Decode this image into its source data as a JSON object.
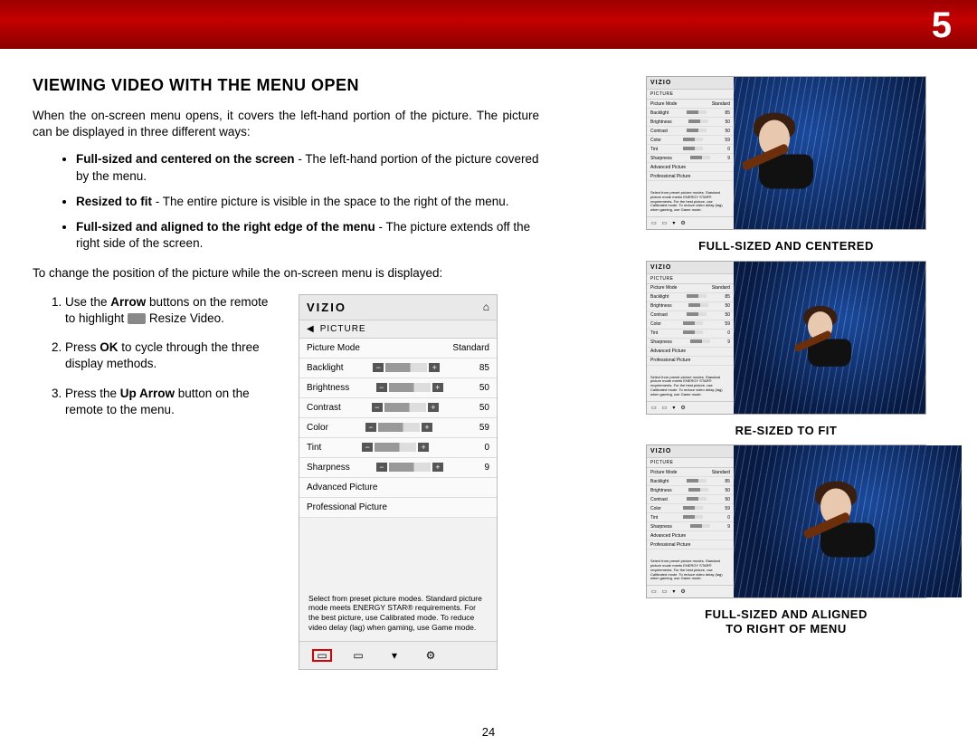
{
  "chapter_number": "5",
  "page_number": "24",
  "section_title": "VIEWING VIDEO WITH THE MENU OPEN",
  "intro": "When the on-screen menu opens, it covers the left-hand portion of the picture. The picture can be displayed in three different ways:",
  "ways": [
    {
      "lead": "Full-sized and centered on the screen",
      "desc": " - The left-hand portion of the picture covered by the menu."
    },
    {
      "lead": "Resized to fit",
      "desc": " - The entire picture is visible in the space to the right of the menu."
    },
    {
      "lead": "Full-sized and aligned to the right edge of the menu",
      "desc": " - The picture extends off the right side of the screen."
    }
  ],
  "change_pos": "To change the position of the picture while the on-screen menu is displayed:",
  "steps": [
    {
      "pre": "Use the ",
      "bold": "Arrow",
      "post": " buttons on the remote to highlight ",
      "tail": " Resize Video.",
      "has_icon": true
    },
    {
      "pre": "Press ",
      "bold": "OK",
      "post": " to cycle through the three display methods.",
      "tail": "",
      "has_icon": false
    },
    {
      "pre": "Press the ",
      "bold": "Up Arrow",
      "post": " button on the remote to the menu.",
      "tail": "",
      "has_icon": false
    }
  ],
  "menu": {
    "brand": "VIZIO",
    "crumb": "PICTURE",
    "rows": [
      {
        "label": "Picture Mode",
        "type": "text",
        "value": "Standard"
      },
      {
        "label": "Backlight",
        "type": "slider",
        "value": "85"
      },
      {
        "label": "Brightness",
        "type": "slider",
        "value": "50"
      },
      {
        "label": "Contrast",
        "type": "slider",
        "value": "50"
      },
      {
        "label": "Color",
        "type": "slider",
        "value": "59"
      },
      {
        "label": "Tint",
        "type": "slider",
        "value": "0"
      },
      {
        "label": "Sharpness",
        "type": "slider",
        "value": "9"
      },
      {
        "label": "Advanced Picture",
        "type": "link"
      },
      {
        "label": "Professional Picture",
        "type": "link"
      }
    ],
    "help": "Select from preset picture modes. Standard picture mode meets ENERGY STAR® requirements. For the best picture, use Calibrated mode. To reduce video delay (lag) when gaming, use Game mode.",
    "footer_icons": [
      "resize-video-icon",
      "wide-icon",
      "chevron-down-icon",
      "gear-icon"
    ]
  },
  "captions": {
    "centered": "FULL-SIZED AND CENTERED",
    "fit": "RE-SIZED TO FIT",
    "aligned1": "FULL-SIZED AND ALIGNED",
    "aligned2": "TO RIGHT OF MENU"
  }
}
